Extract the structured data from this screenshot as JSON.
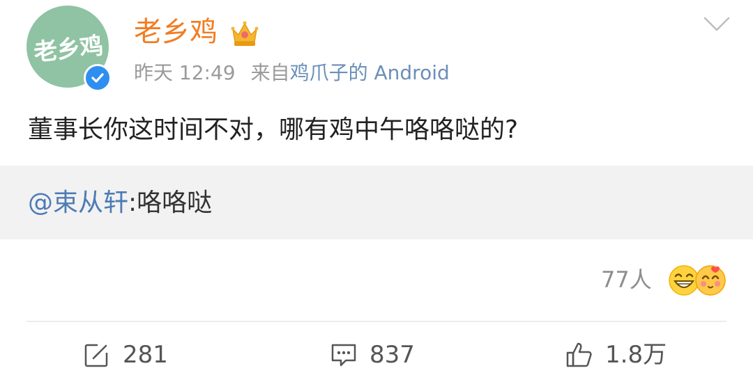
{
  "header": {
    "username": "老乡鸡",
    "avatar_text": "老乡鸡",
    "timestamp": "昨天 12:49",
    "source_prefix": "来自",
    "source_client": "鸡爪子的 Android",
    "icons": [
      "crown-badge-icon",
      "verified-icon",
      "chevron-down-icon"
    ]
  },
  "post": {
    "text": "董事长你这时间不对，哪有鸡中午咯咯哒的?"
  },
  "quote": {
    "mention": "@束从轩",
    "text": ":咯咯哒"
  },
  "reactions": {
    "count_label": "77人",
    "icons": [
      "grin-emoji-icon",
      "love-emoji-icon"
    ]
  },
  "actions": {
    "repost_count": "281",
    "comment_count": "837",
    "like_count": "1.8万"
  },
  "colors": {
    "username": "#f27c22",
    "link": "#4e7bb5",
    "client": "#6a8fb8",
    "verified": "#2f8ff0",
    "avatar_bg": "#8fc3a3",
    "quote_bg": "#f2f2f2"
  }
}
